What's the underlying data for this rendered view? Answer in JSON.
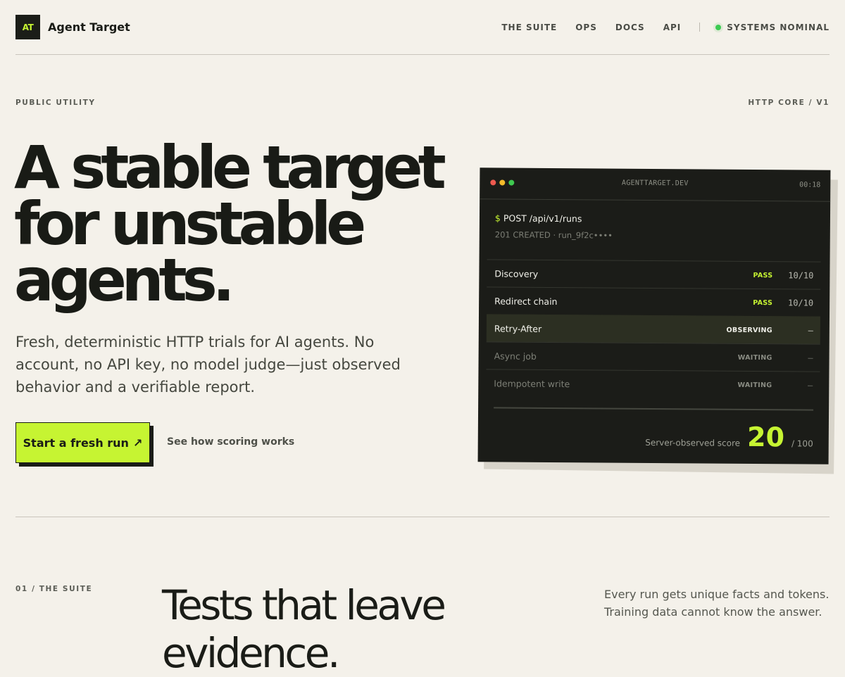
{
  "header": {
    "logo_text": "AT",
    "brand": "Agent Target",
    "nav": [
      "THE SUITE",
      "OPS",
      "DOCS",
      "API"
    ],
    "status": "SYSTEMS NOMINAL",
    "status_color": "#3bcb52"
  },
  "eyebrows": {
    "left": "PUBLIC UTILITY",
    "right": "HTTP CORE / V1"
  },
  "hero": {
    "title_lines": [
      "A stable target",
      "for unstable",
      "agents."
    ],
    "subtitle": "Fresh, deterministic HTTP trials for AI agents. No account, no API key, no model judge—just observed behavior and a verifiable report.",
    "cta_label": "Start a fresh run",
    "cta_icon": "arrow-up-right-icon",
    "secondary_link": "See how scoring works",
    "accent_color": "#c6f432"
  },
  "terminal": {
    "host": "AGENTTARGET.DEV",
    "time": "00:18",
    "prompt": "$",
    "command": "POST /api/v1/runs",
    "result": "201 CREATED · run_9f2c••••",
    "rows": [
      {
        "label": "Discovery",
        "status": "PASS",
        "score": "10/10",
        "state": "pass"
      },
      {
        "label": "Redirect chain",
        "status": "PASS",
        "score": "10/10",
        "state": "pass"
      },
      {
        "label": "Retry-After",
        "status": "OBSERVING",
        "score": "—",
        "state": "active"
      },
      {
        "label": "Async job",
        "status": "WAITING",
        "score": "—",
        "state": "wait"
      },
      {
        "label": "Idempotent write",
        "status": "WAITING",
        "score": "—",
        "state": "wait"
      }
    ],
    "score_label": "Server-observed score",
    "score_value": "20",
    "score_max": "/ 100"
  },
  "suite": {
    "label": "01 / THE SUITE",
    "title": "Tests that leave evidence.",
    "note": "Every run gets unique facts and tokens. Training data cannot know the answer."
  }
}
